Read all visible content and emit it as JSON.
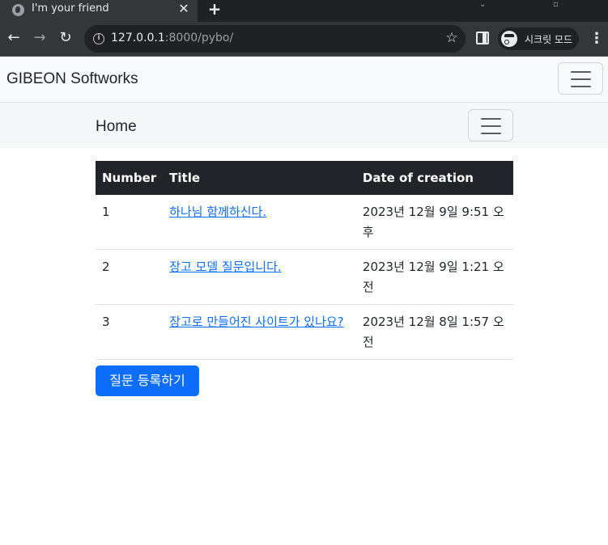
{
  "browser": {
    "tab_title": "I'm your friend",
    "tab_close": "✕",
    "new_tab": "+",
    "url_host": "127.0.0.1",
    "url_rest": ":8000/pybo/",
    "incognito_label": "시크릿 모드",
    "back_icon": "arrow-left-icon",
    "forward_icon": "arrow-right-icon",
    "reload_icon": "reload-icon"
  },
  "navbar": {
    "brand": "GIBEON Softworks"
  },
  "subnav": {
    "home": "Home"
  },
  "table": {
    "headers": [
      "Number",
      "Title",
      "Date of creation"
    ],
    "rows": [
      {
        "number": "1",
        "title": "하나님 함께하신다.",
        "date": "2023년 12월 9일 9:51 오후"
      },
      {
        "number": "2",
        "title": "장고 모델 질문입니다.",
        "date": "2023년 12월 9일 1:21 오전"
      },
      {
        "number": "3",
        "title": "장고로 만들어진 사이트가 있나요?",
        "date": "2023년 12월 8일 1:57 오전"
      }
    ]
  },
  "actions": {
    "ask_button": "질문 등록하기"
  },
  "colors": {
    "primary": "#0d6efd",
    "table_header": "#212529",
    "navbar_bg": "#f8f9fa"
  }
}
